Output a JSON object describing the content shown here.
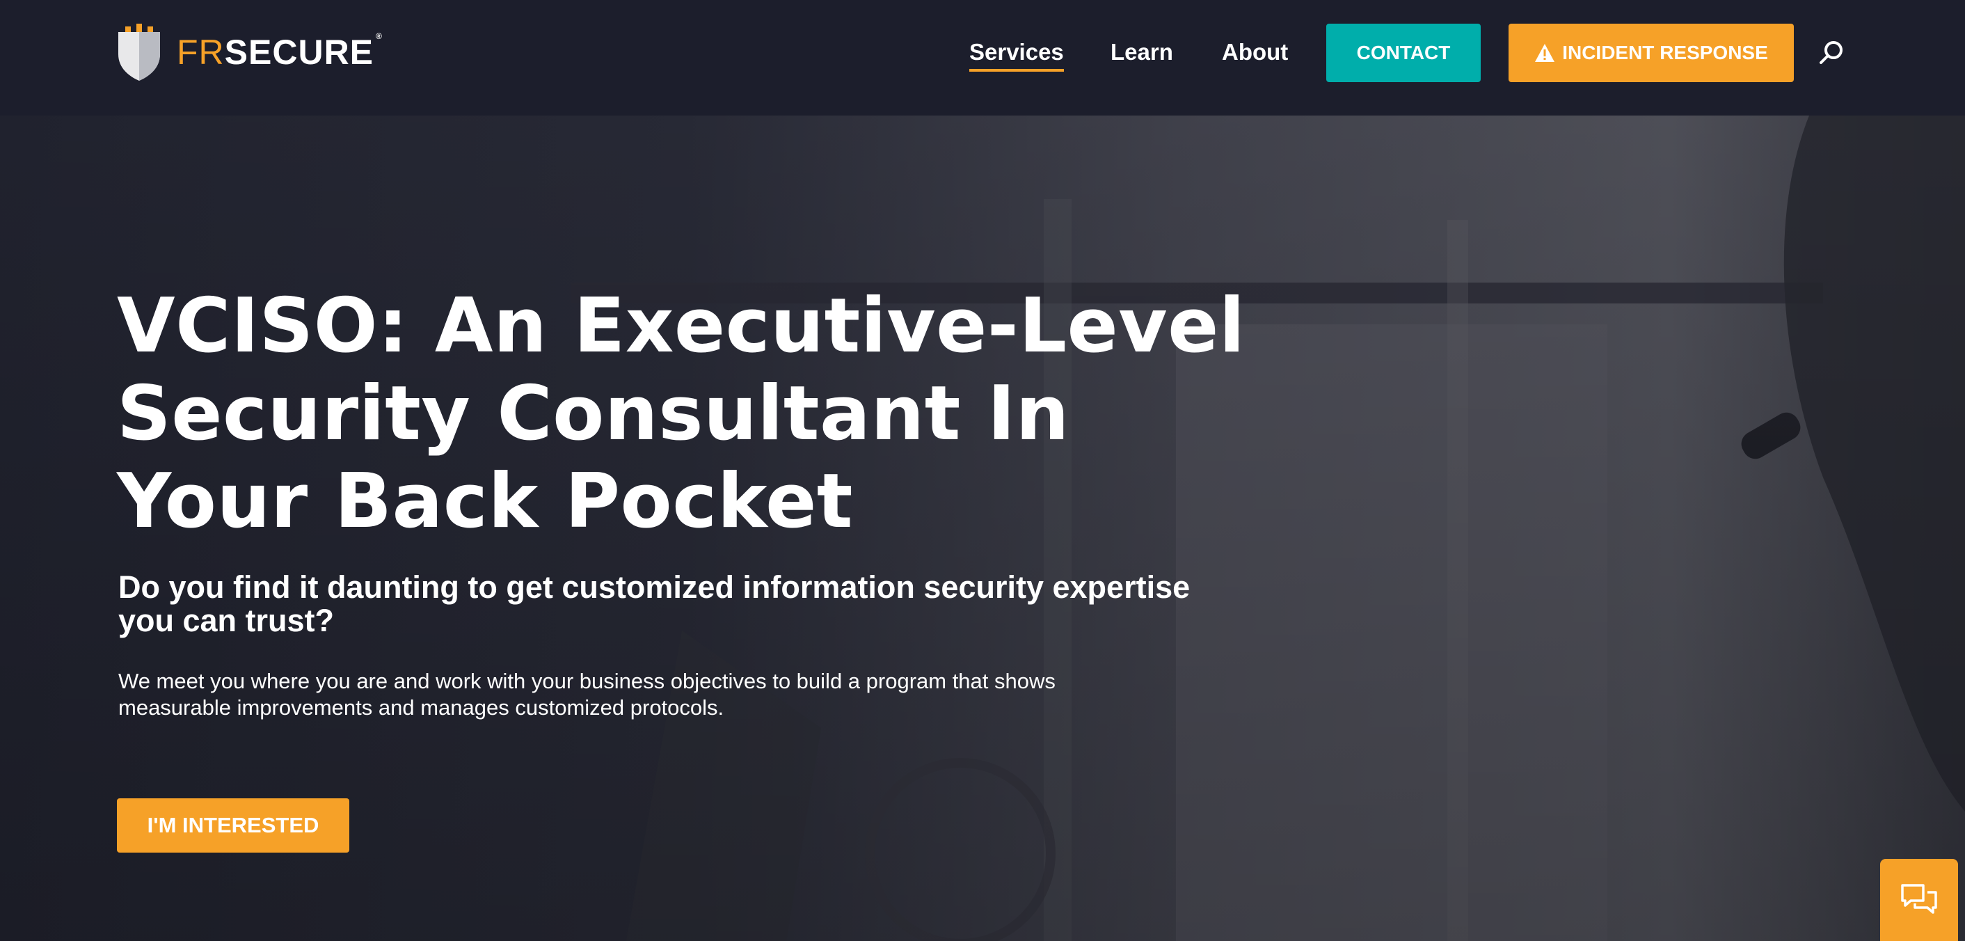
{
  "brand": {
    "logo_prefix": "FR",
    "logo_suffix": "SECURE",
    "registered_mark": "®",
    "accent_orange": "#f6a128",
    "accent_teal": "#00aeab",
    "header_bg": "#1c1e2c"
  },
  "nav": {
    "items": [
      {
        "label": "Services",
        "active": true
      },
      {
        "label": "Learn",
        "active": false
      },
      {
        "label": "About",
        "active": false
      }
    ],
    "contact_label": "CONTACT",
    "incident_label": "INCIDENT RESPONSE",
    "incident_icon": "warning-triangle-icon",
    "search_icon": "search-icon"
  },
  "hero": {
    "title_lines": [
      "VCISO: An Executive-Level",
      "Security Consultant In",
      "Your Back Pocket"
    ],
    "subtitle": "Do you find it daunting to get customized information security expertise you can trust?",
    "body": "We meet you where you are and work with your business objectives to build a program that shows measurable improvements and manages customized protocols.",
    "cta_label": "I'M INTERESTED"
  },
  "chat": {
    "icon": "chat-bubbles-icon"
  }
}
